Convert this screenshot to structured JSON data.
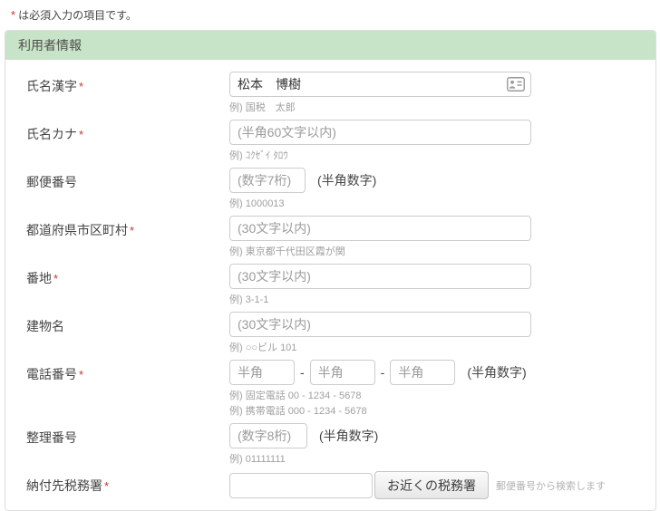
{
  "note": {
    "asterisk": "*",
    "text": "は必須入力の項目です。"
  },
  "required_mark": "*",
  "section": {
    "title": "利用者情報"
  },
  "fields": {
    "name_kanji": {
      "label": "氏名漢字",
      "required": true,
      "value": "松本　博樹",
      "hint": "例) 国税　太郎",
      "icon": "contact-card-icon"
    },
    "name_kana": {
      "label": "氏名カナ",
      "required": true,
      "placeholder": "(半角60文字以内)",
      "hint": "例) ｺｸｾﾞｲ ﾀﾛｳ"
    },
    "postal_code": {
      "label": "郵便番号",
      "required": false,
      "placeholder": "(数字7桁)",
      "suffix": "(半角数字)",
      "hint": "例) 1000013"
    },
    "prefecture_city": {
      "label": "都道府県市区町村",
      "required": true,
      "placeholder": "(30文字以内)",
      "hint": "例) 東京都千代田区霞が関"
    },
    "street_number": {
      "label": "番地",
      "required": true,
      "placeholder": "(30文字以内)",
      "hint": "例) 3-1-1"
    },
    "building_name": {
      "label": "建物名",
      "required": false,
      "placeholder": "(30文字以内)",
      "hint": "例) ○○ビル 101"
    },
    "phone": {
      "label": "電話番号",
      "required": true,
      "placeholder": "半角",
      "separator": "-",
      "suffix": "(半角数字)",
      "hints": [
        "例) 固定電話 00 - 1234 - 5678",
        "例) 携帯電話 000 - 1234 - 5678"
      ]
    },
    "reference_number": {
      "label": "整理番号",
      "required": false,
      "placeholder": "(数字8桁)",
      "suffix": "(半角数字)",
      "hint": "例) 01111111"
    },
    "tax_office": {
      "label": "納付先税務署",
      "required": true,
      "value": "",
      "button_label": "お近くの税務署",
      "note": "郵便番号から検索します"
    }
  },
  "colors": {
    "section_header_bg": "#c8e4c8",
    "required_mark": "#cc3333",
    "input_border": "#cccccc",
    "hint_text": "#a0a0a0",
    "panel_border": "#dddddd"
  }
}
